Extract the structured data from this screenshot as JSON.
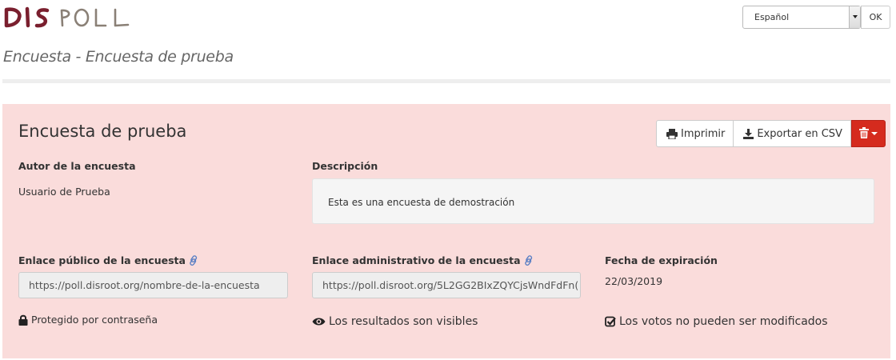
{
  "header": {
    "logo_text": "DISPOLL",
    "language": {
      "selected": "Español",
      "submit_label": "OK"
    }
  },
  "page": {
    "title": "Encuesta - Encuesta de prueba"
  },
  "poll": {
    "title": "Encuesta de prueba",
    "actions": {
      "print_label": "Imprimir",
      "export_label": "Exportar en CSV"
    },
    "author": {
      "label": "Autor de la encuesta",
      "value": "Usuario de Prueba"
    },
    "description": {
      "label": "Descripción",
      "value": "Esta es una encuesta de demostración"
    },
    "public_link": {
      "label": "Enlace público de la encuesta",
      "value": "https://poll.disroot.org/nombre-de-la-encuesta"
    },
    "admin_link": {
      "label": "Enlace administrativo de la encuesta",
      "value": "https://poll.disroot.org/5L2GG2BIxZQYCjsWndFdFn("
    },
    "expiration": {
      "label": "Fecha de expiración",
      "value": "22/03/2019"
    },
    "flags": {
      "password": "Protegido por contraseña",
      "results": "Los resultados son visibles",
      "votes": "Los votos no pueden ser modificados"
    }
  },
  "colors": {
    "panel_bg": "#fadcdb",
    "danger": "#d52b1e",
    "link_icon": "#5a7fc4",
    "logo_dark": "#7a1f2e",
    "logo_light": "#8a8076"
  },
  "icons": {
    "print": "print-icon",
    "export": "download-icon",
    "delete": "trash-icon",
    "link": "link-icon",
    "password": "lock-icon",
    "results": "eye-icon",
    "votes": "check-square-icon"
  }
}
